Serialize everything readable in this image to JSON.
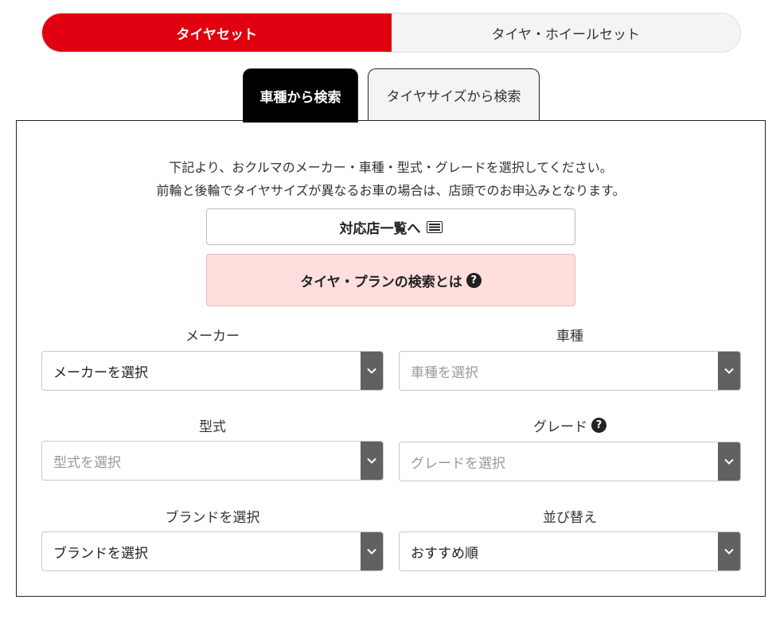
{
  "toggle": {
    "tire_set": "タイヤセット",
    "tire_wheel_set": "タイヤ・ホイールセット"
  },
  "tabs": {
    "by_vehicle": "車種から検索",
    "by_size": "タイヤサイズから検索"
  },
  "intro": {
    "line1": "下記より、おクルマのメーカー・車種・型式・グレードを選択してください。",
    "line2": "前輪と後輪でタイヤサイズが異なるお車の場合は、店頭でのお申込みとなります。"
  },
  "buttons": {
    "stores": "対応店一覧へ",
    "plan": "タイヤ・プランの検索とは"
  },
  "fields": {
    "maker": {
      "label": "メーカー",
      "value": "メーカーを選択"
    },
    "model": {
      "label": "車種",
      "placeholder": "車種を選択"
    },
    "type": {
      "label": "型式",
      "placeholder": "型式を選択"
    },
    "grade": {
      "label": "グレード",
      "placeholder": "グレードを選択"
    },
    "brand": {
      "label": "ブランドを選択",
      "value": "ブランドを選択"
    },
    "sort": {
      "label": "並び替え",
      "value": "おすすめ順"
    }
  },
  "colors": {
    "accent": "#e0000f",
    "plan_bg": "#ffdede",
    "select_arrow_bg": "#616161"
  }
}
